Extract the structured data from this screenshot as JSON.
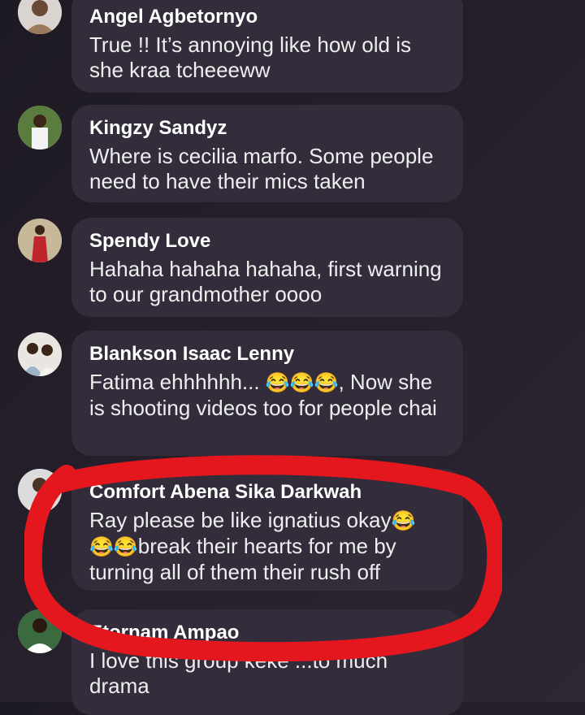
{
  "comments": [
    {
      "name": "Angel Agbetornyo",
      "text": "True !! It’s annoying like how old is she kraa tcheeeww"
    },
    {
      "name": "Kingzy Sandyz",
      "text": "Where is cecilia marfo. Some people need to have their mics taken"
    },
    {
      "name": "Spendy Love",
      "text": "Hahaha hahaha hahaha, first warning to our grandmother oooo"
    },
    {
      "name": "Blankson Isaac Lenny",
      "text_before": "Fatima ehhhhhh... ",
      "emoji": "😂😂😂",
      "text_after": ", Now she is shooting videos too for people chai"
    },
    {
      "name": "Comfort Abena Sika Darkwah",
      "text_before": "Ray please be like ignatius okay",
      "emoji1": "😂",
      "emoji2": "😂😂",
      "text_after": "break their hearts for me by turning all of them their rush off"
    },
    {
      "name": "Etornam Ampao",
      "text": "I love this group keke ...to much drama"
    }
  ],
  "colors": {
    "bubble": "#332d3b",
    "highlight": "#e4171f"
  }
}
